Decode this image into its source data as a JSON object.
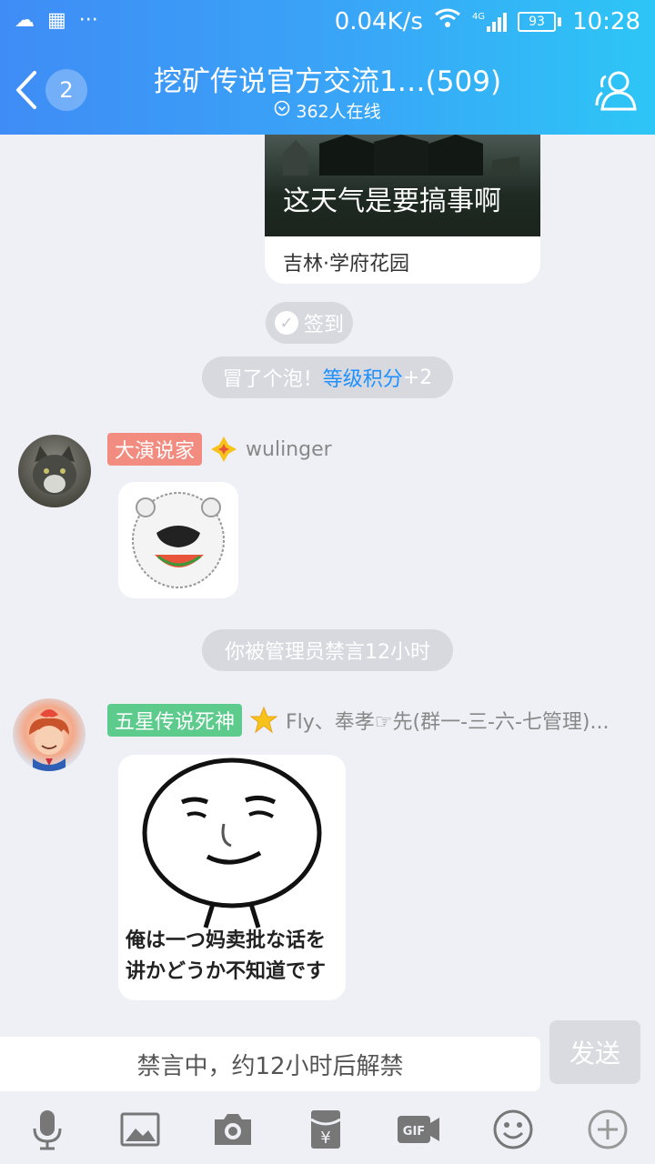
{
  "status_bar": {
    "speed": "0.04K/s",
    "network": "4G",
    "battery": "93",
    "time": "10:28"
  },
  "header": {
    "back_count": "2",
    "title": "挖矿传说官方交流1…(509)",
    "online": "362人在线"
  },
  "messages": {
    "card": {
      "image_text": "这天气是要搞事啊",
      "location": "吉林·学府花园"
    },
    "sign_in": "签到",
    "bubble_notice": {
      "prefix": "冒了个泡！",
      "highlight": "等级积分",
      "suffix": "+2"
    },
    "user1": {
      "title_tag": "大演说家",
      "name": "wulinger"
    },
    "ban_notice": "你被管理员禁言12小时",
    "user2": {
      "title_tag": "五星传说死神",
      "name": "Fly、奉孝☞先(群一-三-六-七管理)..."
    },
    "sticker2_caption_line1": "俺は一つ妈卖批な话を",
    "sticker2_caption_line2": "讲かどうか不知道です"
  },
  "composer": {
    "input_text": "禁言中，约12小时后解禁",
    "send_label": "发送"
  },
  "toolbar": {
    "items": [
      "microphone-icon",
      "image-icon",
      "camera-icon",
      "red-packet-icon",
      "gif-icon",
      "emoji-icon",
      "plus-icon"
    ]
  },
  "colors": {
    "header_start": "#3f8cf6",
    "header_end": "#2dc6f6",
    "highlight": "#1e90ff",
    "tag_red": "#f38c80",
    "tag_green": "#5ccb8c"
  }
}
